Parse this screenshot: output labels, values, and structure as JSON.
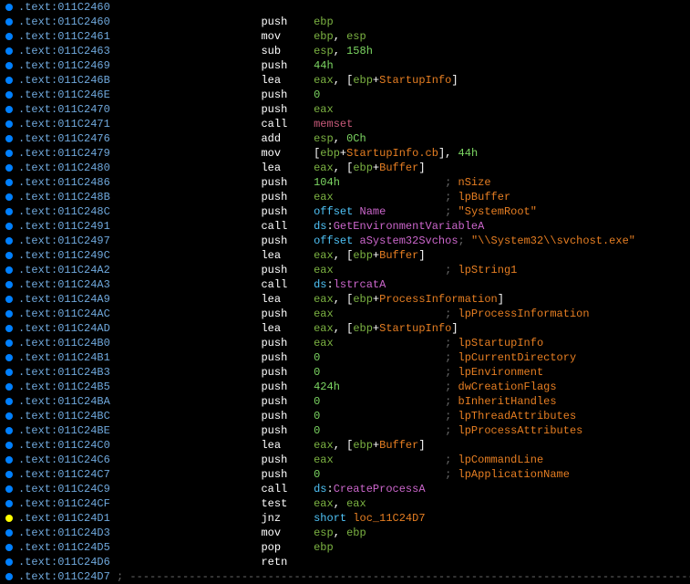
{
  "rows": [
    {
      "bp": "bp",
      "addr": ".text:011C2460",
      "ops": []
    },
    {
      "bp": "bp",
      "addr": ".text:011C2460",
      "mnem": "push",
      "ops": [
        {
          "t": "reg",
          "v": "ebp"
        }
      ]
    },
    {
      "bp": "bp",
      "addr": ".text:011C2461",
      "mnem": "mov",
      "ops": [
        {
          "t": "reg",
          "v": "ebp"
        },
        {
          "t": "comma",
          "v": ", "
        },
        {
          "t": "reg",
          "v": "esp"
        }
      ]
    },
    {
      "bp": "bp",
      "addr": ".text:011C2463",
      "mnem": "sub",
      "ops": [
        {
          "t": "reg",
          "v": "esp"
        },
        {
          "t": "comma",
          "v": ", "
        },
        {
          "t": "num",
          "v": "158h"
        }
      ]
    },
    {
      "bp": "bp",
      "addr": ".text:011C2469",
      "mnem": "push",
      "ops": [
        {
          "t": "num",
          "v": "44h"
        }
      ]
    },
    {
      "bp": "bp",
      "addr": ".text:011C246B",
      "mnem": "lea",
      "ops": [
        {
          "t": "reg",
          "v": "eax"
        },
        {
          "t": "comma",
          "v": ", "
        },
        {
          "t": "punct",
          "v": "["
        },
        {
          "t": "reg",
          "v": "ebp"
        },
        {
          "t": "punct",
          "v": "+"
        },
        {
          "t": "sym",
          "v": "StartupInfo"
        },
        {
          "t": "punct",
          "v": "]"
        }
      ]
    },
    {
      "bp": "bp",
      "addr": ".text:011C246E",
      "mnem": "push",
      "ops": [
        {
          "t": "num",
          "v": "0"
        }
      ]
    },
    {
      "bp": "bp",
      "addr": ".text:011C2470",
      "mnem": "push",
      "ops": [
        {
          "t": "reg",
          "v": "eax"
        }
      ]
    },
    {
      "bp": "bp",
      "addr": ".text:011C2471",
      "mnem": "call",
      "ops": [
        {
          "t": "func",
          "v": "memset"
        }
      ]
    },
    {
      "bp": "bp",
      "addr": ".text:011C2476",
      "mnem": "add",
      "ops": [
        {
          "t": "reg",
          "v": "esp"
        },
        {
          "t": "comma",
          "v": ", "
        },
        {
          "t": "num",
          "v": "0Ch"
        }
      ]
    },
    {
      "bp": "bp",
      "addr": ".text:011C2479",
      "mnem": "mov",
      "ops": [
        {
          "t": "punct",
          "v": "["
        },
        {
          "t": "reg",
          "v": "ebp"
        },
        {
          "t": "punct",
          "v": "+"
        },
        {
          "t": "sym",
          "v": "StartupInfo.cb"
        },
        {
          "t": "punct",
          "v": "]"
        },
        {
          "t": "comma",
          "v": ", "
        },
        {
          "t": "num",
          "v": "44h"
        }
      ]
    },
    {
      "bp": "bp",
      "addr": ".text:011C2480",
      "mnem": "lea",
      "ops": [
        {
          "t": "reg",
          "v": "eax"
        },
        {
          "t": "comma",
          "v": ", "
        },
        {
          "t": "punct",
          "v": "["
        },
        {
          "t": "reg",
          "v": "ebp"
        },
        {
          "t": "punct",
          "v": "+"
        },
        {
          "t": "sym",
          "v": "Buffer"
        },
        {
          "t": "punct",
          "v": "]"
        }
      ]
    },
    {
      "bp": "bp",
      "addr": ".text:011C2486",
      "mnem": "push",
      "ops": [
        {
          "t": "num",
          "v": "104h"
        }
      ],
      "cmt": "nSize"
    },
    {
      "bp": "bp",
      "addr": ".text:011C248B",
      "mnem": "push",
      "ops": [
        {
          "t": "reg",
          "v": "eax"
        }
      ],
      "cmt": "lpBuffer"
    },
    {
      "bp": "bp",
      "addr": ".text:011C248C",
      "mnem": "push",
      "ops": [
        {
          "t": "kw",
          "v": "offset "
        },
        {
          "t": "ext",
          "v": "Name"
        }
      ],
      "cmt_str": "\"SystemRoot\""
    },
    {
      "bp": "bp",
      "addr": ".text:011C2491",
      "mnem": "call",
      "ops": [
        {
          "t": "kw",
          "v": "ds"
        },
        {
          "t": "punct",
          "v": ":"
        },
        {
          "t": "ext",
          "v": "GetEnvironmentVariableA"
        }
      ]
    },
    {
      "bp": "bp",
      "addr": ".text:011C2497",
      "mnem": "push",
      "ops": [
        {
          "t": "kw",
          "v": "offset "
        },
        {
          "t": "ext",
          "v": "aSystem32Svchos"
        }
      ],
      "cmt_str": "\"\\\\System32\\\\svchost.exe\""
    },
    {
      "bp": "bp",
      "addr": ".text:011C249C",
      "mnem": "lea",
      "ops": [
        {
          "t": "reg",
          "v": "eax"
        },
        {
          "t": "comma",
          "v": ", "
        },
        {
          "t": "punct",
          "v": "["
        },
        {
          "t": "reg",
          "v": "ebp"
        },
        {
          "t": "punct",
          "v": "+"
        },
        {
          "t": "sym",
          "v": "Buffer"
        },
        {
          "t": "punct",
          "v": "]"
        }
      ]
    },
    {
      "bp": "bp",
      "addr": ".text:011C24A2",
      "mnem": "push",
      "ops": [
        {
          "t": "reg",
          "v": "eax"
        }
      ],
      "cmt": "lpString1"
    },
    {
      "bp": "bp",
      "addr": ".text:011C24A3",
      "mnem": "call",
      "ops": [
        {
          "t": "kw",
          "v": "ds"
        },
        {
          "t": "punct",
          "v": ":"
        },
        {
          "t": "ext",
          "v": "lstrcatA"
        }
      ]
    },
    {
      "bp": "bp",
      "addr": ".text:011C24A9",
      "mnem": "lea",
      "ops": [
        {
          "t": "reg",
          "v": "eax"
        },
        {
          "t": "comma",
          "v": ", "
        },
        {
          "t": "punct",
          "v": "["
        },
        {
          "t": "reg",
          "v": "ebp"
        },
        {
          "t": "punct",
          "v": "+"
        },
        {
          "t": "sym",
          "v": "ProcessInformation"
        },
        {
          "t": "punct",
          "v": "]"
        }
      ]
    },
    {
      "bp": "bp",
      "addr": ".text:011C24AC",
      "mnem": "push",
      "ops": [
        {
          "t": "reg",
          "v": "eax"
        }
      ],
      "cmt": "lpProcessInformation"
    },
    {
      "bp": "bp",
      "addr": ".text:011C24AD",
      "mnem": "lea",
      "ops": [
        {
          "t": "reg",
          "v": "eax"
        },
        {
          "t": "comma",
          "v": ", "
        },
        {
          "t": "punct",
          "v": "["
        },
        {
          "t": "reg",
          "v": "ebp"
        },
        {
          "t": "punct",
          "v": "+"
        },
        {
          "t": "sym",
          "v": "StartupInfo"
        },
        {
          "t": "punct",
          "v": "]"
        }
      ]
    },
    {
      "bp": "bp",
      "addr": ".text:011C24B0",
      "mnem": "push",
      "ops": [
        {
          "t": "reg",
          "v": "eax"
        }
      ],
      "cmt": "lpStartupInfo"
    },
    {
      "bp": "bp",
      "addr": ".text:011C24B1",
      "mnem": "push",
      "ops": [
        {
          "t": "num",
          "v": "0"
        }
      ],
      "cmt": "lpCurrentDirectory"
    },
    {
      "bp": "bp",
      "addr": ".text:011C24B3",
      "mnem": "push",
      "ops": [
        {
          "t": "num",
          "v": "0"
        }
      ],
      "cmt": "lpEnvironment"
    },
    {
      "bp": "bp",
      "addr": ".text:011C24B5",
      "mnem": "push",
      "ops": [
        {
          "t": "num",
          "v": "424h"
        }
      ],
      "cmt": "dwCreationFlags"
    },
    {
      "bp": "bp",
      "addr": ".text:011C24BA",
      "mnem": "push",
      "ops": [
        {
          "t": "num",
          "v": "0"
        }
      ],
      "cmt": "bInheritHandles"
    },
    {
      "bp": "bp",
      "addr": ".text:011C24BC",
      "mnem": "push",
      "ops": [
        {
          "t": "num",
          "v": "0"
        }
      ],
      "cmt": "lpThreadAttributes"
    },
    {
      "bp": "bp",
      "addr": ".text:011C24BE",
      "mnem": "push",
      "ops": [
        {
          "t": "num",
          "v": "0"
        }
      ],
      "cmt": "lpProcessAttributes"
    },
    {
      "bp": "bp",
      "addr": ".text:011C24C0",
      "mnem": "lea",
      "ops": [
        {
          "t": "reg",
          "v": "eax"
        },
        {
          "t": "comma",
          "v": ", "
        },
        {
          "t": "punct",
          "v": "["
        },
        {
          "t": "reg",
          "v": "ebp"
        },
        {
          "t": "punct",
          "v": "+"
        },
        {
          "t": "sym",
          "v": "Buffer"
        },
        {
          "t": "punct",
          "v": "]"
        }
      ]
    },
    {
      "bp": "bp",
      "addr": ".text:011C24C6",
      "mnem": "push",
      "ops": [
        {
          "t": "reg",
          "v": "eax"
        }
      ],
      "cmt": "lpCommandLine"
    },
    {
      "bp": "bp",
      "addr": ".text:011C24C7",
      "mnem": "push",
      "ops": [
        {
          "t": "num",
          "v": "0"
        }
      ],
      "cmt": "lpApplicationName"
    },
    {
      "bp": "bp",
      "addr": ".text:011C24C9",
      "mnem": "call",
      "ops": [
        {
          "t": "kw",
          "v": "ds"
        },
        {
          "t": "punct",
          "v": ":"
        },
        {
          "t": "ext",
          "v": "CreateProcessA"
        }
      ]
    },
    {
      "bp": "bp",
      "addr": ".text:011C24CF",
      "mnem": "test",
      "ops": [
        {
          "t": "reg",
          "v": "eax"
        },
        {
          "t": "comma",
          "v": ", "
        },
        {
          "t": "reg",
          "v": "eax"
        }
      ]
    },
    {
      "bp": "cur",
      "addr": ".text:011C24D1",
      "mnem": "jnz",
      "ops": [
        {
          "t": "kw",
          "v": "short "
        },
        {
          "t": "loc",
          "v": "loc_11C24D7"
        }
      ]
    },
    {
      "bp": "bp",
      "addr": ".text:011C24D3",
      "mnem": "mov",
      "ops": [
        {
          "t": "reg",
          "v": "esp"
        },
        {
          "t": "comma",
          "v": ", "
        },
        {
          "t": "reg",
          "v": "ebp"
        }
      ]
    },
    {
      "bp": "bp",
      "addr": ".text:011C24D5",
      "mnem": "pop",
      "ops": [
        {
          "t": "reg",
          "v": "ebp"
        }
      ]
    },
    {
      "bp": "bp",
      "addr": ".text:011C24D6",
      "mnem": "retn",
      "ops": []
    },
    {
      "bp": "bp",
      "addr": ".text:011C24D7",
      "sep": true
    }
  ],
  "addr_width": 16,
  "mnem_col": 37,
  "op_col": 45,
  "cmt_col": 65,
  "sep_char": ";"
}
